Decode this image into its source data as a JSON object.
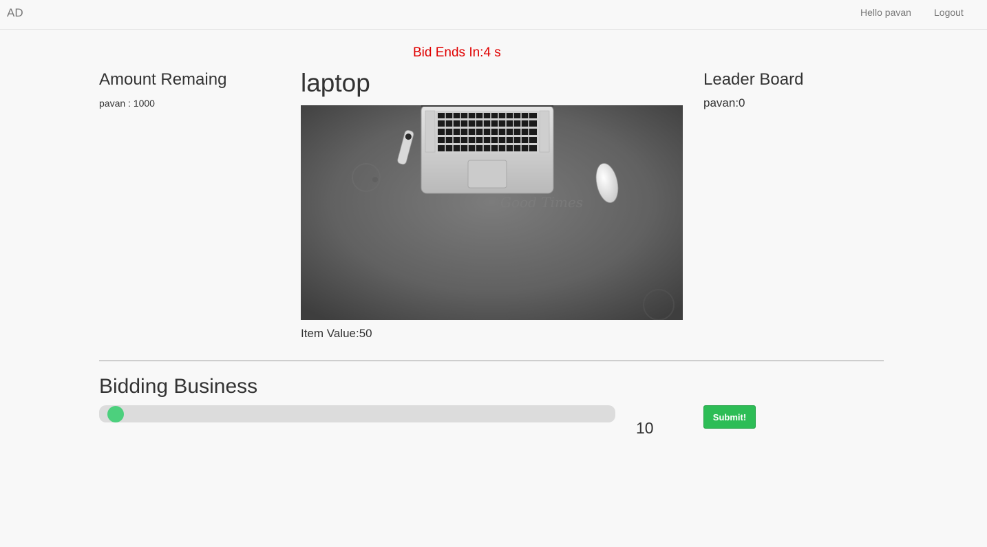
{
  "navbar": {
    "brand": "AD",
    "greeting": "Hello pavan",
    "logout_label": "Logout"
  },
  "countdown": "Bid Ends In:4 s",
  "amount": {
    "title": "Amount Remaing",
    "entry": "pavan : 1000"
  },
  "item": {
    "name": "laptop",
    "value_text": "Item Value:50"
  },
  "leaderboard": {
    "title": "Leader Board",
    "entries": [
      "pavan:0"
    ]
  },
  "bidding": {
    "title": "Bidding Business",
    "slider_level": 0.016,
    "current_bid": "10",
    "submit_label": "Submit!"
  },
  "colors": {
    "countdown": "#e00000",
    "slider_thumb": "#4cd07d",
    "submit_button": "#2dbd56"
  },
  "icons": {
    "product_image": "laptop-desk-photo"
  }
}
